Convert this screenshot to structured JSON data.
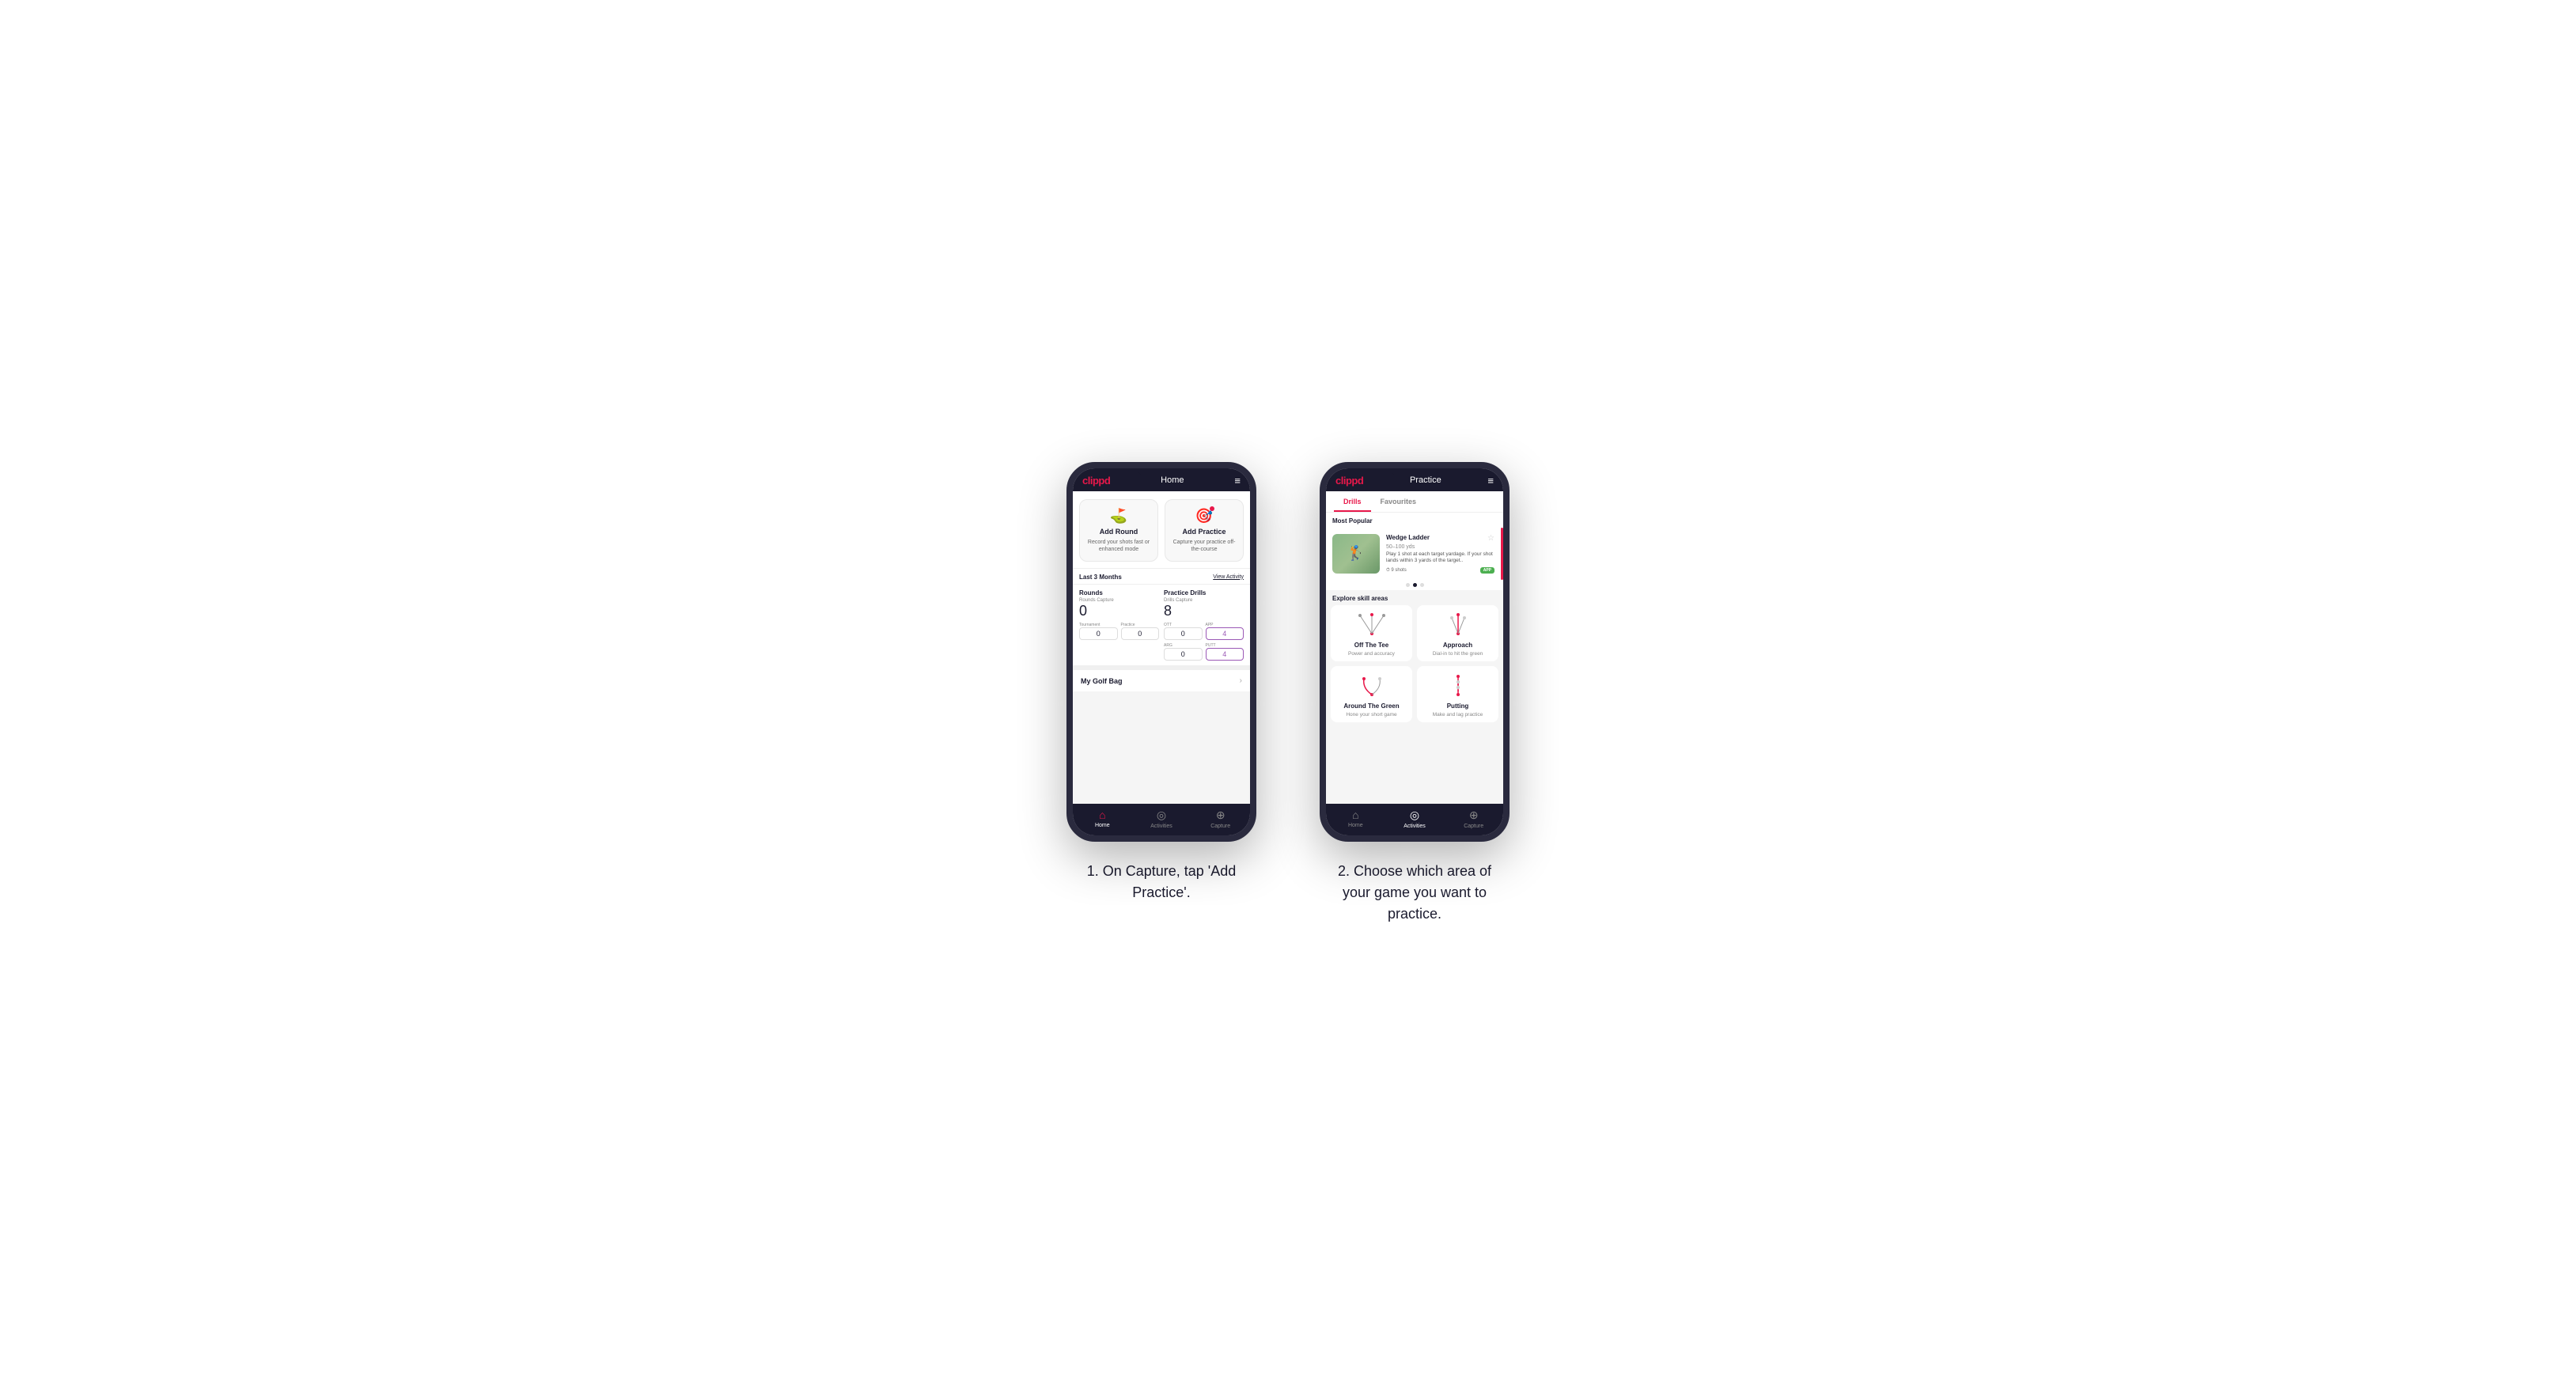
{
  "phones": [
    {
      "id": "phone1",
      "header": {
        "logo": "clippd",
        "title": "Home",
        "menu_icon": "≡"
      },
      "actions": [
        {
          "id": "add-round",
          "icon": "⛳",
          "title": "Add Round",
          "desc": "Record your shots fast or enhanced mode"
        },
        {
          "id": "add-practice",
          "icon": "🎯",
          "title": "Add Practice",
          "desc": "Capture your practice off-the-course"
        }
      ],
      "activity_section": {
        "label": "Last 3 Months",
        "link": "View Activity"
      },
      "stats": {
        "rounds": {
          "title": "Rounds",
          "capture_label": "Rounds Capture",
          "total": "0",
          "sub_items": [
            {
              "tag": "Tournament",
              "value": "0"
            },
            {
              "tag": "Practice",
              "value": "0"
            }
          ]
        },
        "practice_drills": {
          "title": "Practice Drills",
          "capture_label": "Drills Capture",
          "total": "8",
          "sub_items": [
            {
              "tag": "OTT",
              "value": "0"
            },
            {
              "tag": "ARG",
              "value": "0"
            }
          ],
          "sub_items2": [
            {
              "tag": "APP",
              "value": "4",
              "highlight": true
            },
            {
              "tag": "PUTT",
              "value": "4",
              "highlight": true
            }
          ]
        }
      },
      "my_golf_bag": "My Golf Bag",
      "nav": [
        {
          "label": "Home",
          "icon": "⌂",
          "active": true
        },
        {
          "label": "Activities",
          "icon": "◎",
          "active": false
        },
        {
          "label": "Capture",
          "icon": "⊕",
          "active": false
        }
      ]
    },
    {
      "id": "phone2",
      "header": {
        "logo": "clippd",
        "title": "Practice",
        "menu_icon": "≡"
      },
      "tabs": [
        {
          "label": "Drills",
          "active": true
        },
        {
          "label": "Favourites",
          "active": false
        }
      ],
      "most_popular_label": "Most Popular",
      "drill_card": {
        "title": "Wedge Ladder",
        "yards": "50–100 yds",
        "desc": "Play 1 shot at each target yardage. If your shot lands within 3 yards of the target..",
        "shots": "9 shots",
        "badge": "APP"
      },
      "dots": [
        false,
        true,
        false
      ],
      "explore_label": "Explore skill areas",
      "skill_areas": [
        {
          "id": "off-the-tee",
          "name": "Off The Tee",
          "desc": "Power and accuracy"
        },
        {
          "id": "approach",
          "name": "Approach",
          "desc": "Dial-in to hit the green"
        },
        {
          "id": "around-the-green",
          "name": "Around The Green",
          "desc": "Hone your short game"
        },
        {
          "id": "putting",
          "name": "Putting",
          "desc": "Make and lag practice"
        }
      ],
      "nav": [
        {
          "label": "Home",
          "icon": "⌂",
          "active": false
        },
        {
          "label": "Activities",
          "icon": "◎",
          "active": true
        },
        {
          "label": "Capture",
          "icon": "⊕",
          "active": false
        }
      ]
    }
  ],
  "captions": [
    "1. On Capture, tap 'Add Practice'.",
    "2. Choose which area of your game you want to practice."
  ]
}
